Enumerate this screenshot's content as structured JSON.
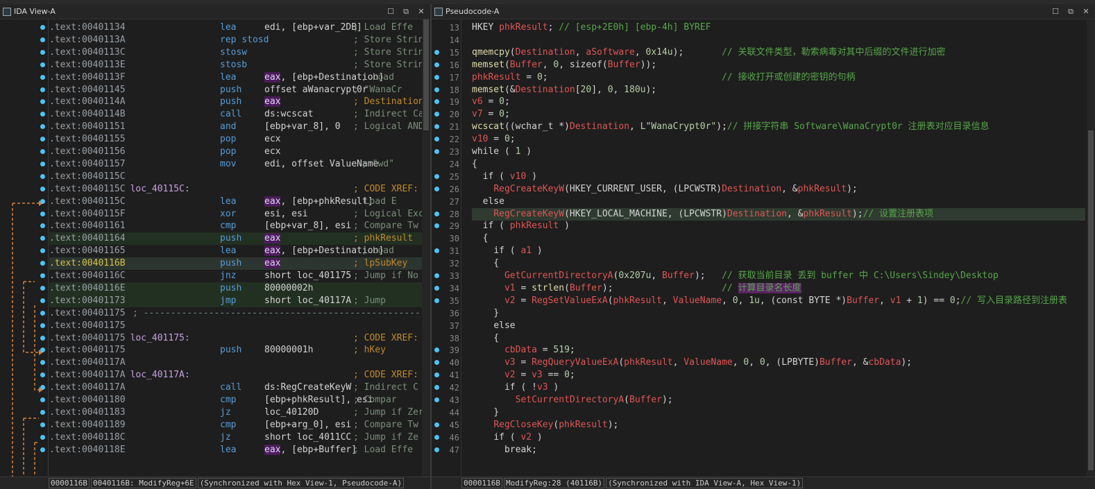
{
  "ida_view": {
    "title": "IDA View-A",
    "status": [
      "0000116B",
      "0040116B: ModifyReg+6E",
      "(Synchronized with Hex View-1, Pseudocode-A)"
    ],
    "lines": [
      {
        "addr": ".text:00401134",
        "label": "",
        "mn": "lea",
        "ops": "edi, [ebp+var_2DB]",
        "cmt": "; Load Effe"
      },
      {
        "addr": ".text:0040113A",
        "label": "",
        "mn": "rep stosd",
        "ops": "",
        "cmt": "; Store Strin"
      },
      {
        "addr": ".text:0040113C",
        "label": "",
        "mn": "stosw",
        "ops": "",
        "cmt": "; Store Strin"
      },
      {
        "addr": ".text:0040113E",
        "label": "",
        "mn": "stosb",
        "ops": "",
        "cmt": "; Store Strin"
      },
      {
        "addr": ".text:0040113F",
        "label": "",
        "mn": "lea",
        "ops": "eax, [ebp+Destination]",
        "cmt": "; Load"
      },
      {
        "addr": ".text:00401145",
        "label": "",
        "mn": "push",
        "ops": "offset aWanacrypt0r",
        "cmt": "; \"WanaCr"
      },
      {
        "addr": ".text:0040114A",
        "label": "",
        "mn": "push",
        "ops": "eax",
        "cmt": "; Destination"
      },
      {
        "addr": ".text:0040114B",
        "label": "",
        "mn": "call",
        "ops": "ds:wcscat",
        "cmt": "; Indirect Ca"
      },
      {
        "addr": ".text:00401151",
        "label": "",
        "mn": "and",
        "ops": "[ebp+var_8], 0",
        "cmt": "; Logical AND"
      },
      {
        "addr": ".text:00401155",
        "label": "",
        "mn": "pop",
        "ops": "ecx",
        "cmt": ""
      },
      {
        "addr": ".text:00401156",
        "label": "",
        "mn": "pop",
        "ops": "ecx",
        "cmt": ""
      },
      {
        "addr": ".text:00401157",
        "label": "",
        "mn": "mov",
        "ops": "edi, offset ValueName",
        "cmt": "; \"wd\""
      },
      {
        "addr": ".text:0040115C",
        "label": "",
        "mn": "",
        "ops": "",
        "cmt": ""
      },
      {
        "addr": ".text:0040115C",
        "label": "loc_40115C:",
        "mn": "",
        "ops": "",
        "cmt": "; CODE XREF:"
      },
      {
        "addr": ".text:0040115C",
        "label": "",
        "mn": "lea",
        "ops": "eax, [ebp+phkResult]",
        "cmt": "; Load E"
      },
      {
        "addr": ".text:0040115F",
        "label": "",
        "mn": "xor",
        "ops": "esi, esi",
        "cmt": "; Logical Exc"
      },
      {
        "addr": ".text:00401161",
        "label": "",
        "mn": "cmp",
        "ops": "[ebp+var_8], esi",
        "cmt": "; Compare Tw"
      },
      {
        "addr": ".text:00401164",
        "label": "",
        "mn": "push",
        "ops": "eax",
        "cmt": "; phkResult"
      },
      {
        "addr": ".text:00401165",
        "label": "",
        "mn": "lea",
        "ops": "eax, [ebp+Destination]",
        "cmt": "; Load"
      },
      {
        "addr": ".text:0040116B",
        "label": "",
        "mn": "push",
        "ops": "eax",
        "cmt": "; lpSubKey"
      },
      {
        "addr": ".text:0040116C",
        "label": "",
        "mn": "jnz",
        "ops": "short loc_401175",
        "cmt": "; Jump if No"
      },
      {
        "addr": ".text:0040116E",
        "label": "",
        "mn": "push",
        "ops": "80000002h",
        "cmt": ""
      },
      {
        "addr": ".text:00401173",
        "label": "",
        "mn": "jmp",
        "ops": "short loc_40117A",
        "cmt": "; Jump"
      },
      {
        "addr": ".text:00401175",
        "label": "",
        "mn": "",
        "ops": "",
        "cmt": "; -----------------------------------------------------------------"
      },
      {
        "addr": ".text:00401175",
        "label": "",
        "mn": "",
        "ops": "",
        "cmt": ""
      },
      {
        "addr": ".text:00401175",
        "label": "loc_401175:",
        "mn": "",
        "ops": "",
        "cmt": "; CODE XREF:"
      },
      {
        "addr": ".text:00401175",
        "label": "",
        "mn": "push",
        "ops": "80000001h",
        "cmt": "; hKey"
      },
      {
        "addr": ".text:0040117A",
        "label": "",
        "mn": "",
        "ops": "",
        "cmt": ""
      },
      {
        "addr": ".text:0040117A",
        "label": "loc_40117A:",
        "mn": "",
        "ops": "",
        "cmt": "; CODE XREF:"
      },
      {
        "addr": ".text:0040117A",
        "label": "",
        "mn": "call",
        "ops": "ds:RegCreateKeyW",
        "cmt": "; Indirect C"
      },
      {
        "addr": ".text:00401180",
        "label": "",
        "mn": "cmp",
        "ops": "[ebp+phkResult], esi",
        "cmt": "; Compar"
      },
      {
        "addr": ".text:00401183",
        "label": "",
        "mn": "jz",
        "ops": "loc_40120D",
        "cmt": "; Jump if Zer"
      },
      {
        "addr": ".text:00401189",
        "label": "",
        "mn": "cmp",
        "ops": "[ebp+arg_0], esi",
        "cmt": "; Compare Tw"
      },
      {
        "addr": ".text:0040118C",
        "label": "",
        "mn": "jz",
        "ops": "short loc_4011CC",
        "cmt": "; Jump if Ze"
      },
      {
        "addr": ".text:0040118E",
        "label": "",
        "mn": "lea",
        "ops": "eax, [ebp+Buffer]",
        "cmt": "; Load Effe"
      }
    ]
  },
  "pseudocode": {
    "title": "Pseudocode-A",
    "status": [
      "0000116B",
      "ModifyReg:28 (40116B)",
      "(Synchronized with IDA View-A, Hex View-1)"
    ],
    "line_numbers": [
      "13",
      "14",
      "15",
      "16",
      "17",
      "18",
      "19",
      "20",
      "21",
      "22",
      "23",
      "24",
      "25",
      "26",
      "27",
      "28",
      "29",
      "30",
      "31",
      "32",
      "33",
      "34",
      "35",
      "36",
      "37",
      "38",
      "39",
      "40",
      "41",
      "42",
      "43",
      "44",
      "45",
      "46",
      "47"
    ],
    "lines": [
      "HKEY phkResult; // [esp+2E0h] [ebp-4h] BYREF",
      "",
      "qmemcpy(Destination, aSoftware, 0x14u);       // 关联文件类型，勒索病毒对其中后缀的文件进行加密",
      "memset(Buffer, 0, sizeof(Buffer));",
      "phkResult = 0;                                // 接收打开或创建的密钥的句柄",
      "memset(&Destination[20], 0, 180u);",
      "v6 = 0;",
      "v7 = 0;",
      "wcscat((wchar_t *)Destination, L\"WanaCrypt0r\");// 拼接字符串 Software\\WanaCrypt0r 注册表对应目录信息",
      "v10 = 0;",
      "while ( 1 )",
      "{",
      "  if ( v10 )",
      "    RegCreateKeyW(HKEY_CURRENT_USER, (LPCWSTR)Destination, &phkResult);",
      "  else",
      "    RegCreateKeyW(HKEY_LOCAL_MACHINE, (LPCWSTR)Destination, &phkResult);// 设置注册表项",
      "  if ( phkResult )",
      "  {",
      "    if ( a1 )",
      "    {",
      "      GetCurrentDirectoryA(0x207u, Buffer);   // 获取当前目录 丢到 buffer 中 C:\\Users\\Sindey\\Desktop",
      "      v1 = strlen(Buffer);                    // 计算目录名长度",
      "      v2 = RegSetValueExA(phkResult, ValueName, 0, 1u, (const BYTE *)Buffer, v1 + 1) == 0;// 写入目录路径到注册表",
      "    }",
      "    else",
      "    {",
      "      cbData = 519;",
      "      v3 = RegQueryValueExA(phkResult, ValueName, 0, 0, (LPBYTE)Buffer, &cbData);",
      "      v2 = v3 == 0;",
      "      if ( !v3 )",
      "        SetCurrentDirectoryA(Buffer);",
      "    }",
      "    RegCloseKey(phkResult);",
      "    if ( v2 )",
      "      break;"
    ]
  },
  "colors": {
    "accent_dot": "#4fc3f7",
    "xref_arrow": "#d9823b",
    "highlight_purple": "#5a2464"
  }
}
